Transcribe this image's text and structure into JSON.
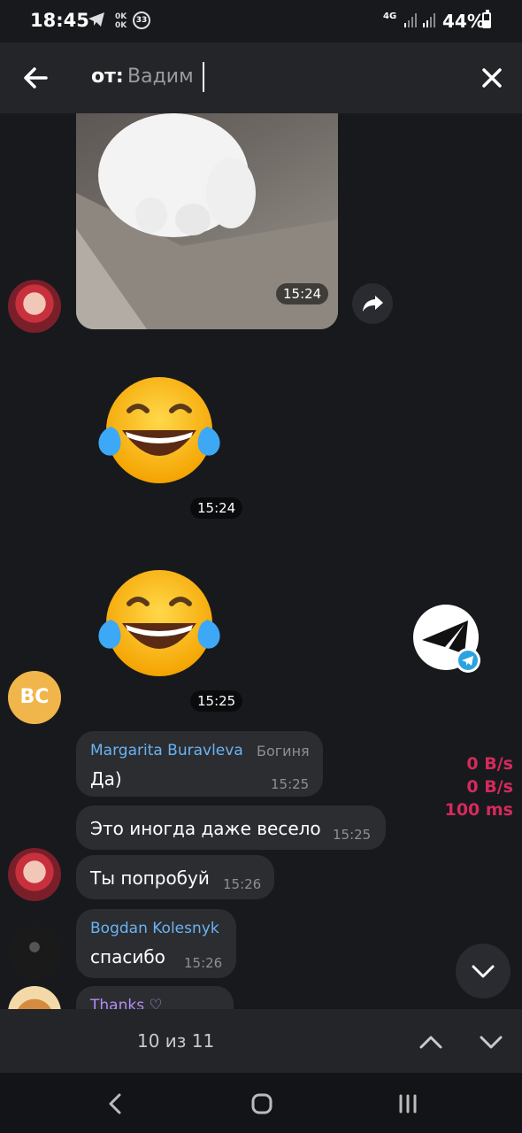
{
  "status_bar": {
    "time": "18:45",
    "ok_icon": "0K 0K",
    "notification_count": "33",
    "network": "4G",
    "battery": "44%"
  },
  "top_bar": {
    "prefix": "от:",
    "query": "Вадим",
    "back_icon": "arrow-left-icon",
    "close_icon": "close-icon"
  },
  "messages": {
    "photo_time": "15:24",
    "emoji1_time": "15:24",
    "emoji2_time": "15:25",
    "avatar_bc_initials": "BC",
    "group1": {
      "sender": "Margarita Buravleva",
      "role": "Богиня",
      "m1_text": "Да)",
      "m1_time": "15:25",
      "m2_text": "Это иногда даже весело",
      "m2_time": "15:25",
      "m3_text": "Ты попробуй",
      "m3_time": "15:26"
    },
    "group2": {
      "sender": "Bogdan Kolesnyk",
      "m1_text": "спасибо",
      "m1_time": "15:26"
    },
    "group3": {
      "sender": "Thanks ♡"
    }
  },
  "overlay_stats": {
    "down": "0 B/s",
    "up": "0 B/s",
    "ping": "100 ms"
  },
  "search_nav": {
    "counter": "10 из 11"
  },
  "colors": {
    "background": "#18191d",
    "bubble": "#2c2d31",
    "name_blue": "#6ab3f3",
    "name_purple": "#b18cf3",
    "stats_red": "#d42a5c"
  }
}
